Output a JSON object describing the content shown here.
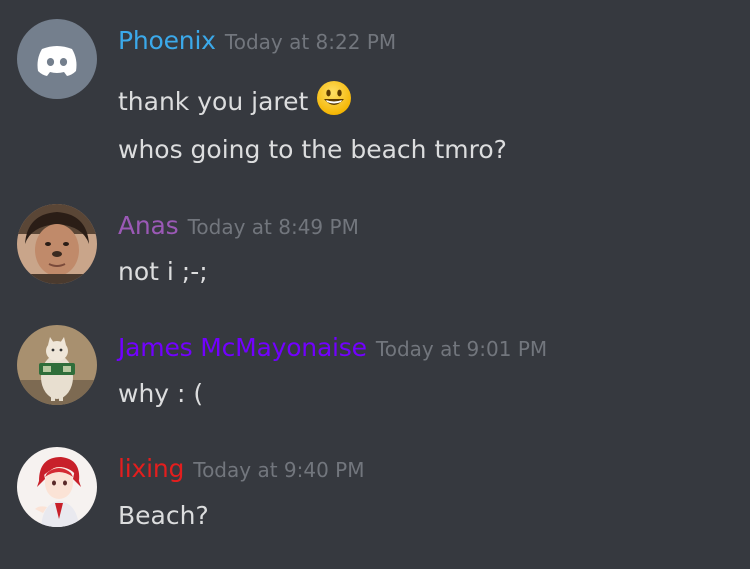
{
  "messages": [
    {
      "username": "Phoenix",
      "timestamp": "Today at 8:22 PM",
      "color": "#3ba9ea",
      "avatar": "discord-default-avatar",
      "lines": [
        "thank you jaret",
        "whos going to the beach tmro?"
      ],
      "emoji": "smiley"
    },
    {
      "username": "Anas",
      "timestamp": "Today at 8:49 PM",
      "color": "#9b59b6",
      "avatar": "user-photo-avatar",
      "lines": [
        "not i ;-;"
      ]
    },
    {
      "username": "James McMayonaise",
      "timestamp": "Today at 9:01 PM",
      "color": "#7200ff",
      "avatar": "cat-photo-avatar",
      "lines": [
        "why : ("
      ]
    },
    {
      "username": "lixing",
      "timestamp": "Today at 9:40 PM",
      "color": "#e31e1e",
      "avatar": "anime-character-avatar",
      "lines": [
        "Beach?"
      ]
    }
  ],
  "colors": {
    "background": "#36393f",
    "timestamp": "#72767d",
    "message_text": "#dcddde"
  }
}
